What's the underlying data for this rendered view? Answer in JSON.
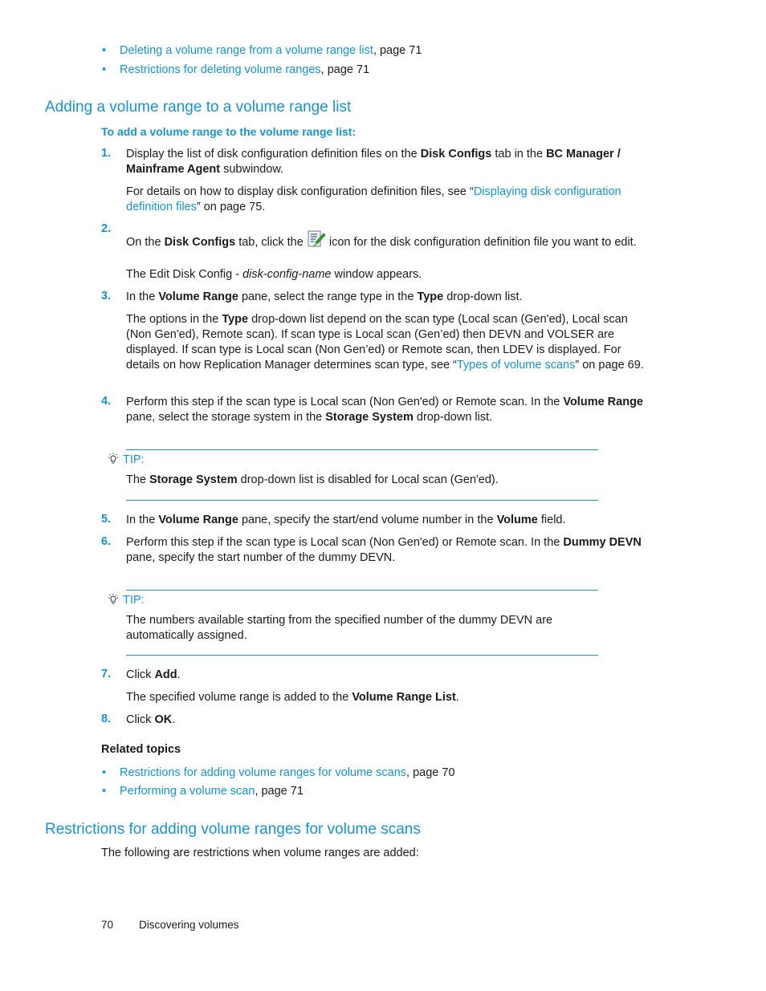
{
  "top_links": [
    {
      "link": "Deleting a volume range from a volume range list",
      "suffix": ", page 71"
    },
    {
      "link": "Restrictions for deleting volume ranges",
      "suffix": ", page 71"
    }
  ],
  "section1": {
    "heading": "Adding a volume range to a volume range list",
    "procedure_title": "To add a volume range to the volume range list:"
  },
  "steps": {
    "s1": {
      "num": "1.",
      "t1": "Display the list of disk configuration definition files on the ",
      "b1": "Disk Configs",
      "t2": " tab in the ",
      "b2": "BC Manager / Mainframe Agent",
      "t3": " subwindow.",
      "detail_pre": "For details on how to display disk configuration definition files, see “",
      "detail_link": "Displaying disk configuration definition files",
      "detail_post": "” on page 75."
    },
    "s2": {
      "num": "2.",
      "t1": "On the ",
      "b1": "Disk Configs",
      "t2": " tab, click the ",
      "t3": " icon for the disk configuration definition file you want to edit.",
      "detail_pre": "The Edit Disk Config - ",
      "detail_italic": "disk-config-name",
      "detail_post": " window appears."
    },
    "s3": {
      "num": "3.",
      "t1": "In the ",
      "b1": "Volume Range",
      "t2": " pane, select the range type in the ",
      "b2": "Type",
      "t3": " drop-down list.",
      "detail_pre": "The options in the ",
      "detail_bold": "Type",
      "detail_mid": " drop-down list depend on the scan type (Local scan (Gen'ed), Local scan (Non Gen'ed), Remote scan). If scan type is Local scan (Gen’ed) then DEVN and VOLSER are displayed. If scan type is Local scan (Non Gen’ed) or Remote scan, then LDEV is displayed. For details on how Replication Manager determines scan type, see “",
      "detail_link": "Types of volume scans",
      "detail_post": "” on page 69."
    },
    "s4": {
      "num": "4.",
      "t1": "Perform this step if the scan type is Local scan (Non Gen'ed) or Remote scan. In the ",
      "b1": "Volume Range",
      "t2": " pane, select the storage system in the ",
      "b2": "Storage System",
      "t3": " drop-down list."
    },
    "s5": {
      "num": "5.",
      "t1": "In the ",
      "b1": "Volume Range",
      "t2": " pane, specify the start/end volume number in the ",
      "b2": "Volume",
      "t3": " field."
    },
    "s6": {
      "num": "6.",
      "t1": "Perform this step if the scan type is Local scan (Non Gen'ed) or Remote scan. In the ",
      "b1": "Dummy DEVN",
      "t2": " pane, specify the start number of the dummy DEVN."
    },
    "s7": {
      "num": "7.",
      "t1": "Click ",
      "b1": "Add",
      "t2": ".",
      "detail_pre": "The specified volume range is added to the ",
      "detail_bold": "Volume Range List",
      "detail_post": "."
    },
    "s8": {
      "num": "8.",
      "t1": "Click ",
      "b1": "OK",
      "t2": "."
    }
  },
  "tips": [
    {
      "label": "TIP:",
      "pre": "The ",
      "bold": "Storage System",
      "post": " drop-down list is disabled for Local scan (Gen'ed)."
    },
    {
      "label": "TIP:",
      "text": "The numbers available starting from the specified number of the dummy DEVN are automatically assigned."
    }
  ],
  "related": {
    "title": "Related topics",
    "items": [
      {
        "link": "Restrictions for adding volume ranges for volume scans",
        "suffix": ", page 70"
      },
      {
        "link": "Performing a volume scan",
        "suffix": ", page 71"
      }
    ]
  },
  "section2": {
    "heading": "Restrictions for adding volume ranges for volume scans",
    "intro": "The following are restrictions when volume ranges are added:"
  },
  "footer": {
    "page_number": "70",
    "chapter": "Discovering volumes"
  },
  "colors": {
    "accent": "#1a93c8",
    "text": "#1a1a1a"
  }
}
